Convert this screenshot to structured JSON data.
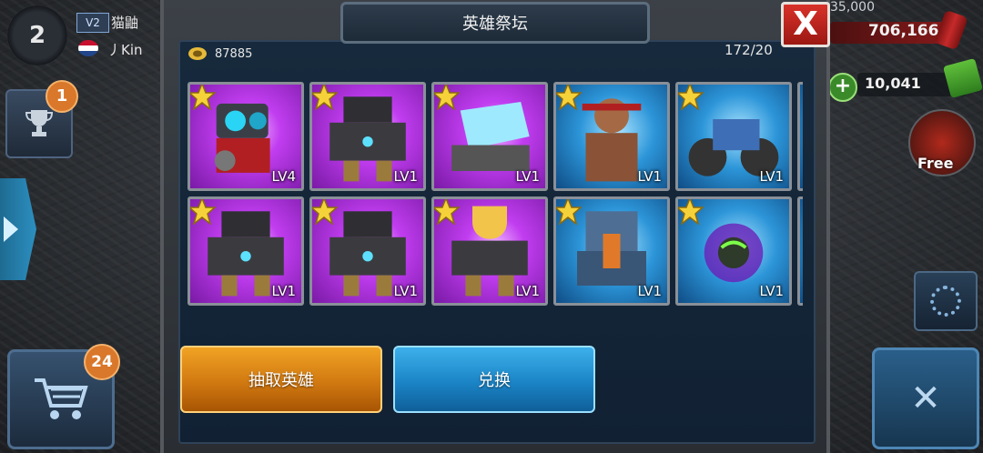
{
  "hud": {
    "level": "2",
    "vip": "V2",
    "player_name": "猫鼬",
    "clan_name": "丿Kin",
    "trophy_notification": "1",
    "shop_notification": "24",
    "resource_cap": "35,000",
    "oil_amount": "706,166",
    "cash_amount": "10,041",
    "free_label": "Free"
  },
  "modal": {
    "title": "英雄祭坛",
    "close_symbol": "X",
    "currency_amount": "87885",
    "capacity": "172/20",
    "cards": [
      {
        "level": "LV4",
        "bg": "purple",
        "icon": "robot-turret"
      },
      {
        "level": "LV1",
        "bg": "purple",
        "icon": "mech-walker"
      },
      {
        "level": "LV1",
        "bg": "purple",
        "icon": "crystal-mech"
      },
      {
        "level": "LV1",
        "bg": "blue",
        "icon": "commando"
      },
      {
        "level": "LV1",
        "bg": "blue",
        "icon": "assault-bike"
      },
      {
        "level": "LV1",
        "bg": "purple",
        "icon": "mech-walker"
      },
      {
        "level": "LV1",
        "bg": "purple",
        "icon": "mech-walker"
      },
      {
        "level": "LV1",
        "bg": "purple",
        "icon": "trophy-mech"
      },
      {
        "level": "LV1",
        "bg": "blue",
        "icon": "armored-tank"
      },
      {
        "level": "LV1",
        "bg": "blue",
        "icon": "purple-orb"
      }
    ],
    "draw_button": "抽取英雄",
    "exchange_button": "兑换"
  },
  "colors": {
    "orange_button": "#d17911",
    "blue_button": "#1b84c6",
    "close_red": "#c52820",
    "purple_card": "#c13df0",
    "blue_card": "#2c95d8"
  }
}
